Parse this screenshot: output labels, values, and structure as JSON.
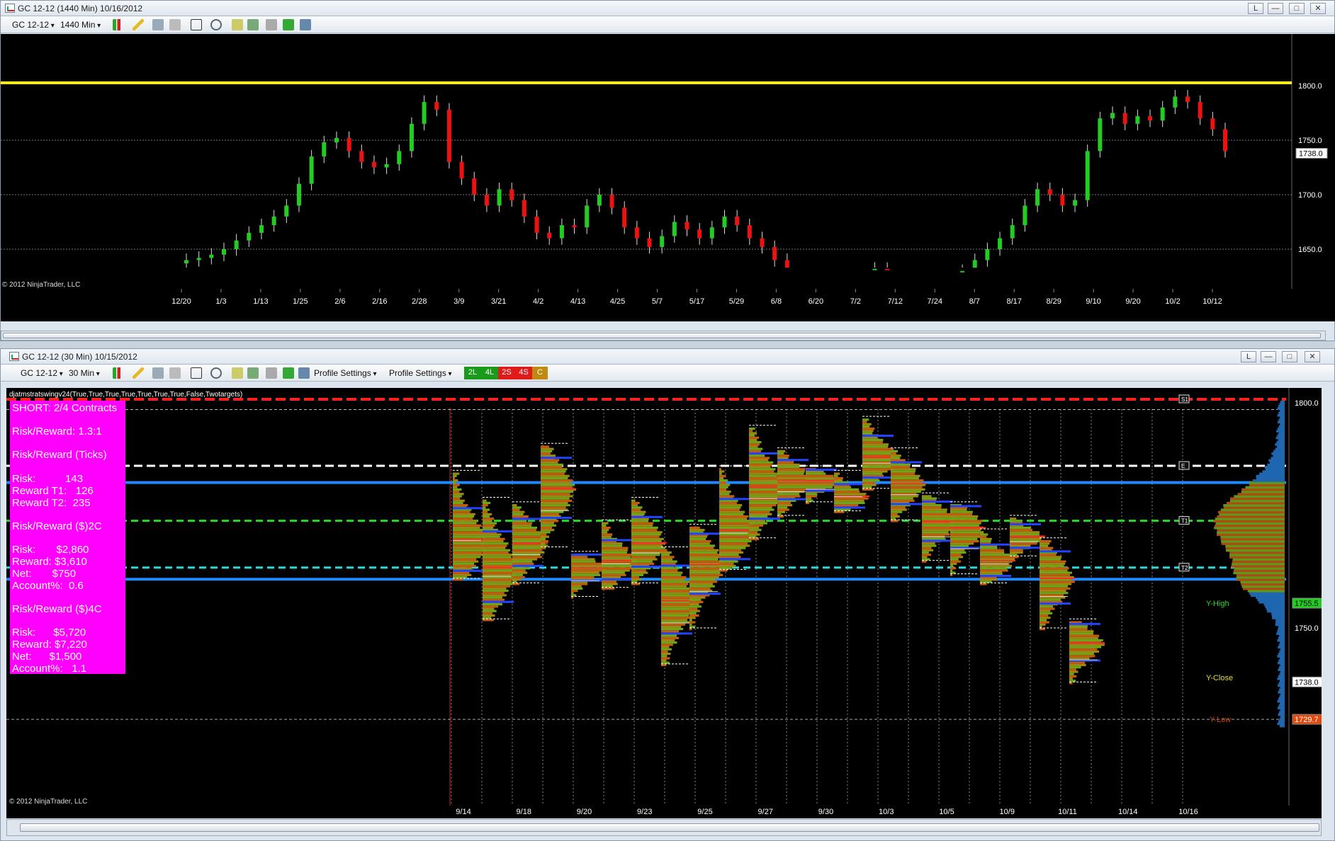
{
  "top_window": {
    "title": "GC 12-12 (1440 Min)  10/16/2012",
    "instrument": "GC 12-12",
    "interval": "1440 Min",
    "copyright": "© 2012 NinjaTrader, LLC",
    "price_labels": [
      "1800.0",
      "1750.0",
      "1700.0",
      "1650.0"
    ],
    "last_price": "1738.0",
    "date_labels": [
      "12/20",
      "1/3",
      "1/13",
      "1/25",
      "2/6",
      "2/16",
      "2/28",
      "3/9",
      "3/21",
      "4/2",
      "4/13",
      "4/25",
      "5/7",
      "5/17",
      "5/29",
      "6/8",
      "6/20",
      "7/2",
      "7/12",
      "7/24",
      "8/7",
      "8/17",
      "8/29",
      "9/10",
      "9/20",
      "10/2",
      "10/12"
    ]
  },
  "bottom_window": {
    "title": "GC 12-12 (30 Min)  10/15/2012",
    "instrument": "GC 12-12",
    "interval": "30 Min",
    "profile_settings_1": "Profile Settings",
    "profile_settings_2": "Profile Settings",
    "mode_buttons": [
      "2L",
      "4L",
      "2S",
      "4S",
      "C"
    ],
    "indicator_text": "djatmstratswingv24(True,True,True,True,True,True,True,False,Twotargets)",
    "copyright": "© 2012 NinjaTrader, LLC",
    "price_labels": [
      "1800.0",
      "1750.0"
    ],
    "tag_yhigh": "1755.5",
    "tag_last": "1738.0",
    "tag_low": "1729.7",
    "level_labels": {
      "s1": "S1",
      "e": "E",
      "t1": "T1",
      "t2": "T2"
    },
    "annotations": {
      "y_high": "Y-High",
      "y_close": "Y-Close",
      "y_low": "Y-Low"
    },
    "date_labels": [
      "9/14",
      "9/18",
      "9/20",
      "9/23",
      "9/25",
      "9/27",
      "9/30",
      "10/3",
      "10/5",
      "10/9",
      "10/11",
      "10/14",
      "10/16"
    ]
  },
  "risk_panel": {
    "line1": "SHORT: 2/4 Contracts",
    "line2": "Risk/Reward: 1.3:1",
    "line3": "Risk/Reward (Ticks)",
    "line4": "Risk:          143",
    "line5": "Reward T1:   126",
    "line6": "Reward T2:  235",
    "line7": "Risk/Reward ($)2C",
    "line8": "Risk:       $2,860",
    "line9": "Reward: $3,610",
    "line10": "Net:       $750",
    "line11": "Account%:  0.6",
    "line12": "Risk/Reward ($)4C",
    "line13": "Risk:      $5,720",
    "line14": "Reward: $7,220",
    "line15": "Net:      $1,500",
    "line16": "Account%:   1.1"
  },
  "colors": {
    "up_candle": "#22cc22",
    "down_candle": "#ee1111",
    "resistance_line": "#ffee00",
    "stop_line": "#ff2020",
    "entry_line": "#ffffff",
    "target1_line": "#22dd22",
    "target2_line": "#22dddd",
    "blue_band": "#2288ff",
    "panel": "#ff00ff"
  },
  "window_buttons": {
    "l": "L",
    "min": "—",
    "max": "□",
    "close": "✕"
  }
}
